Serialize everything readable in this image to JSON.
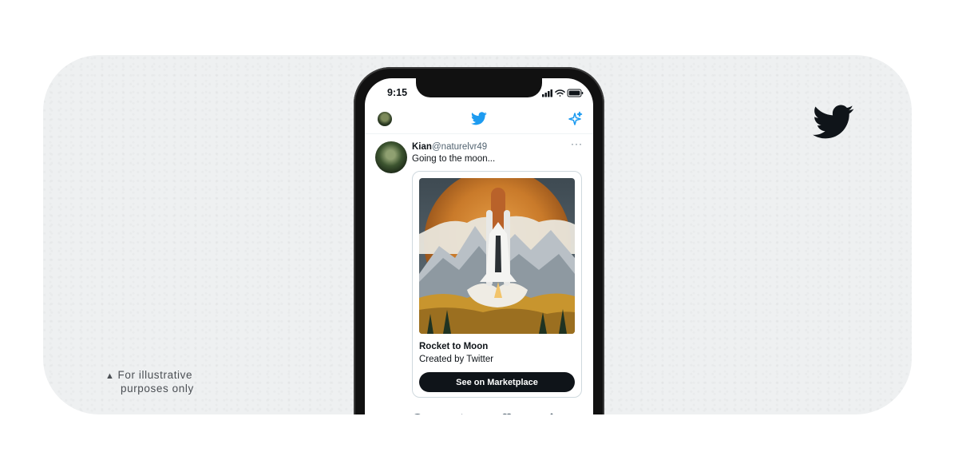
{
  "disclaimer": {
    "icon": "warning-icon",
    "line1": "For illustrative",
    "line2": "purposes only"
  },
  "brand": {
    "icon": "twitter-bird-icon",
    "color": "#0f1419"
  },
  "phone": {
    "status_bar": {
      "time": "9:15",
      "icons": [
        "signal-icon",
        "wifi-icon",
        "battery-icon"
      ]
    },
    "header": {
      "center_icon": "twitter-bird-icon",
      "right_icon": "sparkle-icon",
      "accent": "#1d9bf0"
    },
    "tweet": {
      "name": "Kian",
      "handle": "@naturelvr49",
      "text": "Going to the moon...",
      "more": "···",
      "card": {
        "title": "Rocket to Moon",
        "creator": "Created by Twitter",
        "button": "See on Marketplace"
      },
      "actions": [
        "reply-icon",
        "retweet-icon",
        "like-icon",
        "share-icon"
      ]
    }
  }
}
